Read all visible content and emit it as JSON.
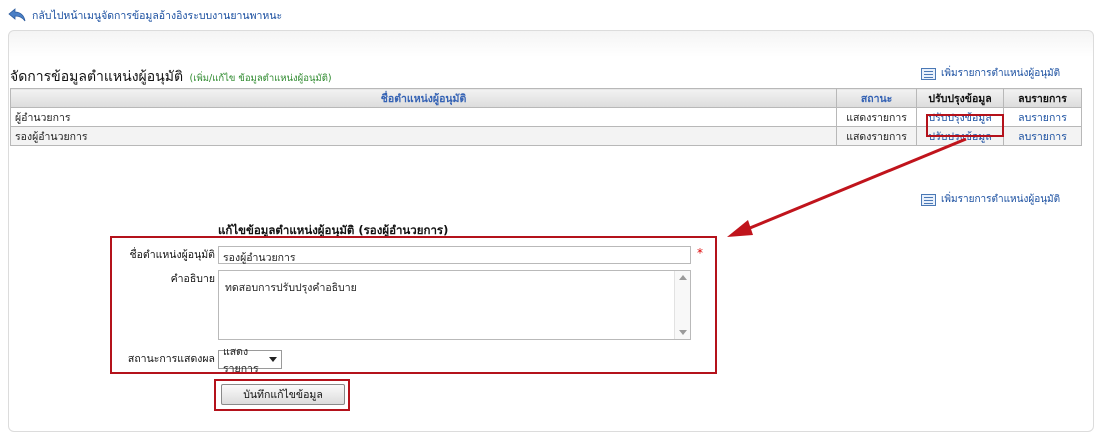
{
  "nav": {
    "back_label": "กลับไปหน้าเมนูจัดการข้อมูลอ้างอิงระบบงานยานพาหนะ",
    "back_icon": "back-arrow-icon"
  },
  "section": {
    "title": "จัดการข้อมูลตำแหน่งผู้อนุมัติ",
    "subtitle": "(เพิ่ม/แก้ไข ข้อมูลตำแหน่งผู้อนุมัติ)",
    "add_link_label": "เพิ่มรายการตำแหน่งผู้อนุมัติ",
    "add_icon": "list-add-icon"
  },
  "table": {
    "headers": [
      "ชื่อตำแหน่งผู้อนุมัติ",
      "สถานะ",
      "ปรับปรุงข้อมูล",
      "ลบรายการ"
    ],
    "rows": [
      {
        "name": "ผู้อำนวยการ",
        "status": "แสดงรายการ",
        "edit": "ปรับปรุงข้อมูล",
        "delete": "ลบรายการ"
      },
      {
        "name": "รองผู้อำนวยการ",
        "status": "แสดงรายการ",
        "edit": "ปรับปรุงข้อมูล",
        "delete": "ลบรายการ"
      }
    ]
  },
  "form": {
    "title": "แก้ไขข้อมูลตำแหน่งผู้อนุมัติ (รองผู้อำนวยการ)",
    "name_label": "ชื่อตำแหน่งผู้อนุมัติ",
    "name_value": "รองผู้อำนวยการ",
    "required_mark": "*",
    "desc_label": "คำอธิบาย",
    "desc_value": "ทดสอบการปรับปรุงคำอธิบาย",
    "status_label": "สถานะการแสดงผล",
    "status_value": "แสดงรายการ",
    "save_label": "บันทึกแก้ไขข้อมูล"
  },
  "colors": {
    "link": "#1a4fa0",
    "highlight": "#b4121b",
    "subtitle": "#2e8a2e",
    "required": "#dd0000"
  }
}
